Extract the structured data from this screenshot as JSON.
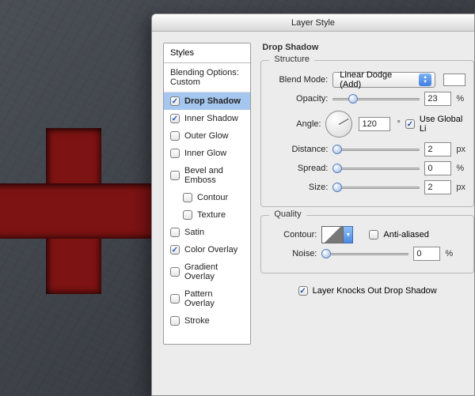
{
  "window": {
    "title": "Layer Style"
  },
  "sidebar": {
    "header": "Styles",
    "blending": "Blending Options: Custom",
    "items": [
      {
        "label": "Drop Shadow",
        "checked": true,
        "selected": true
      },
      {
        "label": "Inner Shadow",
        "checked": true
      },
      {
        "label": "Outer Glow",
        "checked": false
      },
      {
        "label": "Inner Glow",
        "checked": false
      },
      {
        "label": "Bevel and Emboss",
        "checked": false
      },
      {
        "label": "Contour",
        "checked": false,
        "indent": true
      },
      {
        "label": "Texture",
        "checked": false,
        "indent": true
      },
      {
        "label": "Satin",
        "checked": false
      },
      {
        "label": "Color Overlay",
        "checked": true
      },
      {
        "label": "Gradient Overlay",
        "checked": false
      },
      {
        "label": "Pattern Overlay",
        "checked": false
      },
      {
        "label": "Stroke",
        "checked": false
      }
    ]
  },
  "panel": {
    "title": "Drop Shadow",
    "structure": {
      "legend": "Structure",
      "blend_mode_label": "Blend Mode:",
      "blend_mode_value": "Linear Dodge (Add)",
      "opacity_label": "Opacity:",
      "opacity_value": "23",
      "opacity_unit": "%",
      "angle_label": "Angle:",
      "angle_value": "120",
      "angle_unit": "°",
      "use_global_label": "Use Global Li",
      "use_global_checked": true,
      "distance_label": "Distance:",
      "distance_value": "2",
      "distance_unit": "px",
      "spread_label": "Spread:",
      "spread_value": "0",
      "spread_unit": "%",
      "size_label": "Size:",
      "size_value": "2",
      "size_unit": "px"
    },
    "quality": {
      "legend": "Quality",
      "contour_label": "Contour:",
      "antialiased_label": "Anti-aliased",
      "antialiased_checked": false,
      "noise_label": "Noise:",
      "noise_value": "0",
      "noise_unit": "%"
    },
    "knocks_label": "Layer Knocks Out Drop Shadow",
    "knocks_checked": true
  }
}
